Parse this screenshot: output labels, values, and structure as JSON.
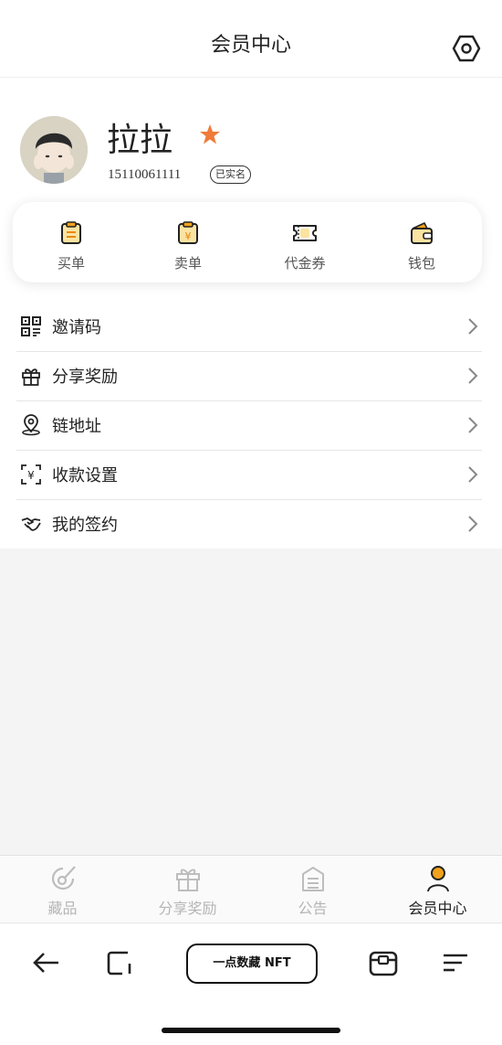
{
  "header": {
    "title": "会员中心"
  },
  "profile": {
    "name": "拉拉",
    "phone": "15110061111",
    "verified_badge": "已实名",
    "star_color": "#ef7b3a"
  },
  "quick_actions": [
    {
      "label": "买单",
      "icon": "buy-order-icon"
    },
    {
      "label": "卖单",
      "icon": "sell-order-icon"
    },
    {
      "label": "代金券",
      "icon": "voucher-icon"
    },
    {
      "label": "钱包",
      "icon": "wallet-icon"
    }
  ],
  "menu": [
    {
      "label": "邀请码",
      "icon": "qr-code-icon"
    },
    {
      "label": "分享奖励",
      "icon": "gift-icon"
    },
    {
      "label": "链地址",
      "icon": "location-pin-icon"
    },
    {
      "label": "收款设置",
      "icon": "yuan-scan-icon"
    },
    {
      "label": "我的签约",
      "icon": "handshake-icon"
    }
  ],
  "tabbar": [
    {
      "label": "藏品",
      "icon": "collection-icon",
      "active": false
    },
    {
      "label": "分享奖励",
      "icon": "gift-icon",
      "active": false
    },
    {
      "label": "公告",
      "icon": "announcement-icon",
      "active": false
    },
    {
      "label": "会员中心",
      "icon": "member-icon",
      "active": true
    }
  ],
  "browser": {
    "url_label": "一点数藏 NFT"
  },
  "colors": {
    "accent": "#f0a21c",
    "accent_fill": "#fbe3a2"
  }
}
